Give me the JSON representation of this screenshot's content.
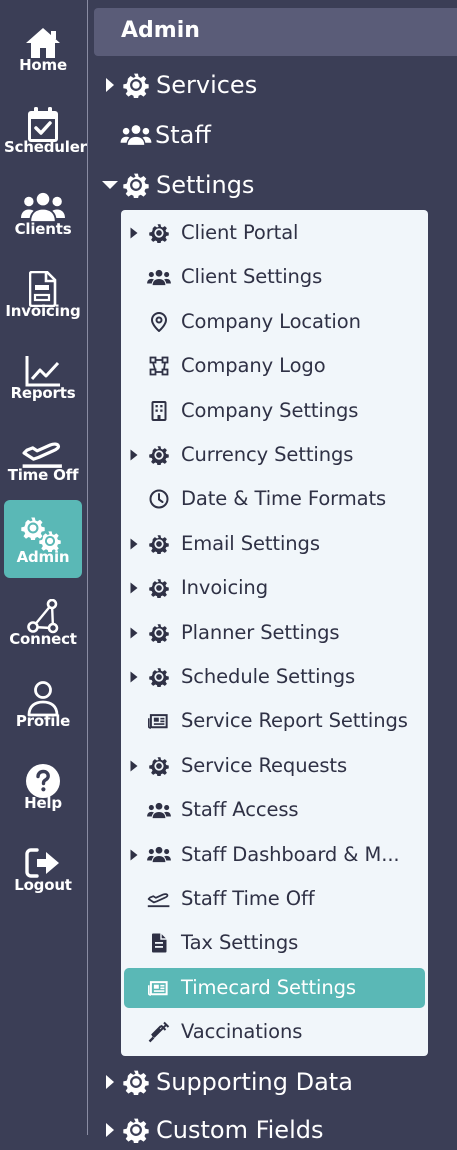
{
  "nav": [
    {
      "label": "Home",
      "icon": "home-icon"
    },
    {
      "label": "Scheduler",
      "icon": "calendar-check-icon"
    },
    {
      "label": "Clients",
      "icon": "users-icon"
    },
    {
      "label": "Invoicing",
      "icon": "invoice-icon"
    },
    {
      "label": "Reports",
      "icon": "chart-line-icon"
    },
    {
      "label": "Time Off",
      "icon": "plane-icon"
    },
    {
      "label": "Admin",
      "icon": "gears-icon",
      "active": true
    },
    {
      "label": "Connect",
      "icon": "connect-icon"
    },
    {
      "label": "Profile",
      "icon": "user-icon"
    },
    {
      "label": "Help",
      "icon": "help-icon"
    },
    {
      "label": "Logout",
      "icon": "logout-icon"
    }
  ],
  "tree": {
    "header": "Admin",
    "services": "Services",
    "staff": "Staff",
    "settings": "Settings",
    "supporting_data": "Supporting Data",
    "custom_fields": "Custom Fields"
  },
  "settings_items": [
    {
      "label": "Client Portal",
      "icon": "gear-icon",
      "expandable": true
    },
    {
      "label": "Client Settings",
      "icon": "users-icon",
      "expandable": false
    },
    {
      "label": "Company Location",
      "icon": "map-pin-icon",
      "expandable": false
    },
    {
      "label": "Company Logo",
      "icon": "vector-shape-icon",
      "expandable": false
    },
    {
      "label": "Company Settings",
      "icon": "building-icon",
      "expandable": false
    },
    {
      "label": "Currency Settings",
      "icon": "gear-icon",
      "expandable": true
    },
    {
      "label": "Date & Time Formats",
      "icon": "clock-icon",
      "expandable": false
    },
    {
      "label": "Email Settings",
      "icon": "gear-icon",
      "expandable": true
    },
    {
      "label": "Invoicing",
      "icon": "gear-icon",
      "expandable": true
    },
    {
      "label": "Planner Settings",
      "icon": "gear-icon",
      "expandable": true
    },
    {
      "label": "Schedule Settings",
      "icon": "gear-icon",
      "expandable": true
    },
    {
      "label": "Service Report Settings",
      "icon": "newspaper-icon",
      "expandable": false
    },
    {
      "label": "Service Requests",
      "icon": "gear-icon",
      "expandable": true
    },
    {
      "label": "Staff Access",
      "icon": "users-icon",
      "expandable": false
    },
    {
      "label": "Staff Dashboard & M...",
      "icon": "users-icon",
      "expandable": true
    },
    {
      "label": "Staff Time Off",
      "icon": "plane-icon",
      "expandable": false
    },
    {
      "label": "Tax Settings",
      "icon": "document-icon",
      "expandable": false
    },
    {
      "label": "Timecard Settings",
      "icon": "newspaper-icon",
      "expandable": false,
      "selected": true
    },
    {
      "label": "Vaccinations",
      "icon": "syringe-icon",
      "expandable": false
    }
  ],
  "colors": {
    "sidebar_bg": "#3b3e56",
    "active_accent": "#5ab8b6",
    "panel_bg": "#f1f6fa",
    "header_bg": "#5a5c78"
  }
}
